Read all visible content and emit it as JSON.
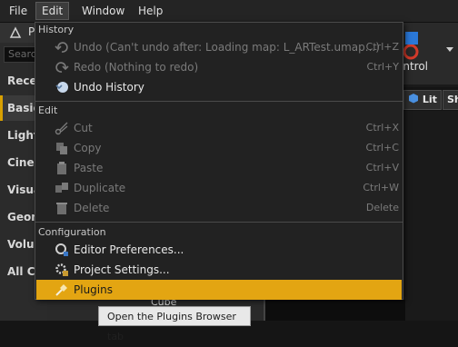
{
  "menubar": {
    "items": [
      "File",
      "Edit",
      "Window",
      "Help"
    ]
  },
  "background": {
    "tab_label": "P",
    "search_placeholder": "Search",
    "categories": [
      "Recen",
      "Basic",
      "Lights",
      "Cinem",
      "Visua",
      "Geom",
      "Volum",
      "All Cla"
    ],
    "selected_category": "Basic",
    "toolbar_label": "ontrol",
    "viewport_buttons": [
      "Lit",
      "Sh"
    ],
    "partial_label": "Cube",
    "tooltip": "Open the Plugins Browser tab"
  },
  "edit_menu": {
    "sections": {
      "history": "History",
      "edit": "Edit",
      "configuration": "Configuration"
    },
    "history_items": [
      {
        "label": "Undo (Can't undo after: Loading map: L_ARTest.umap...)",
        "shortcut": "Ctrl+Z",
        "enabled": false,
        "icon": "undo-icon"
      },
      {
        "label": "Redo (Nothing to redo)",
        "shortcut": "Ctrl+Y",
        "enabled": false,
        "icon": "redo-icon"
      },
      {
        "label": "Undo History",
        "shortcut": "",
        "enabled": true,
        "icon": "undo-history-icon"
      }
    ],
    "edit_items": [
      {
        "label": "Cut",
        "shortcut": "Ctrl+X",
        "enabled": false,
        "icon": "scissors-icon"
      },
      {
        "label": "Copy",
        "shortcut": "Ctrl+C",
        "enabled": false,
        "icon": "copy-icon"
      },
      {
        "label": "Paste",
        "shortcut": "Ctrl+V",
        "enabled": false,
        "icon": "paste-icon"
      },
      {
        "label": "Duplicate",
        "shortcut": "Ctrl+W",
        "enabled": false,
        "icon": "duplicate-icon"
      },
      {
        "label": "Delete",
        "shortcut": "Delete",
        "enabled": false,
        "icon": "trash-icon"
      }
    ],
    "config_items": [
      {
        "label": "Editor Preferences...",
        "shortcut": "",
        "enabled": true,
        "icon": "preferences-icon"
      },
      {
        "label": "Project Settings...",
        "shortcut": "",
        "enabled": true,
        "icon": "settings-gear-icon"
      },
      {
        "label": "Plugins",
        "shortcut": "",
        "enabled": true,
        "highlighted": true,
        "icon": "plug-icon"
      }
    ]
  },
  "colors": {
    "accent": "#e3a512",
    "menu_bg": "#222222",
    "disabled_text": "#7a7a7a"
  }
}
